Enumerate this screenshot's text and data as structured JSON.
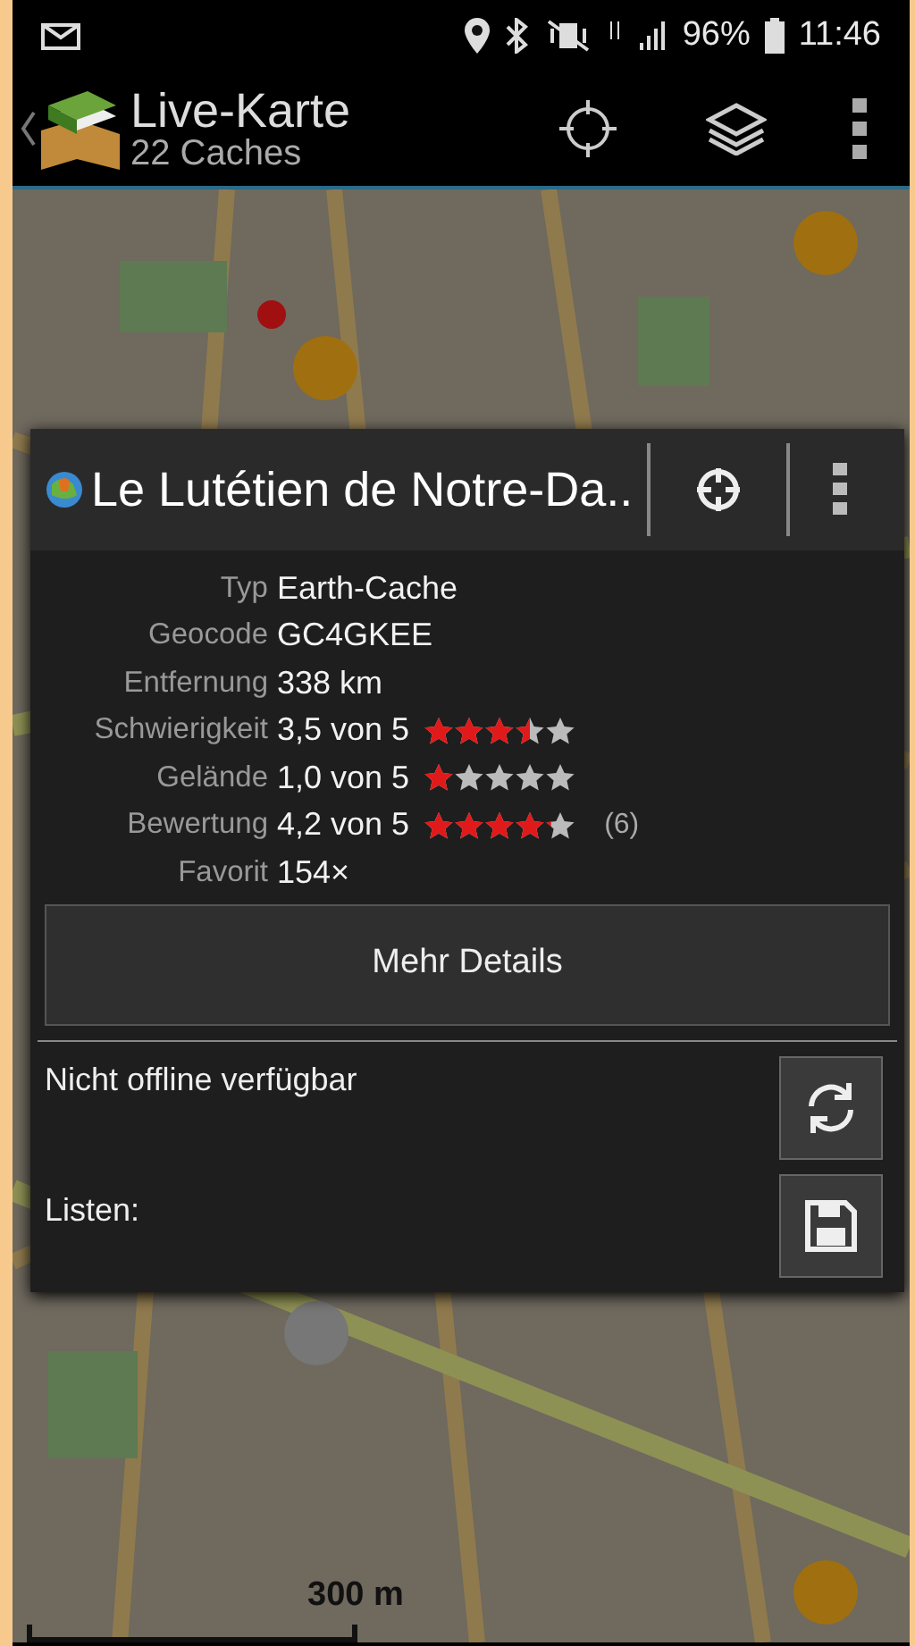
{
  "status_bar": {
    "battery": "96%",
    "time": "11:46"
  },
  "action_bar": {
    "title": "Live-Karte",
    "subtitle": "22 Caches"
  },
  "map": {
    "scale": "300 m"
  },
  "cache_popup": {
    "title": "Le Lutétien de Notre-Da..",
    "details": [
      {
        "label": "Typ",
        "value": "Earth-Cache"
      },
      {
        "label": "Geocode",
        "value": "GC4GKEE"
      },
      {
        "label": "Entfernung",
        "value": "338 km"
      },
      {
        "label": "Schwierigkeit",
        "value": "3,5 von 5",
        "stars": 3.5
      },
      {
        "label": "Gelände",
        "value": "1,0 von 5",
        "stars": 1
      },
      {
        "label": "Bewertung",
        "value": "4,2 von 5",
        "stars": 4.2,
        "count": "(6)"
      },
      {
        "label": "Favorit",
        "value": "154×"
      }
    ],
    "details_button": "Mehr Details",
    "offline_status": "Nicht offline verfügbar",
    "lists_label": "Listen:"
  }
}
